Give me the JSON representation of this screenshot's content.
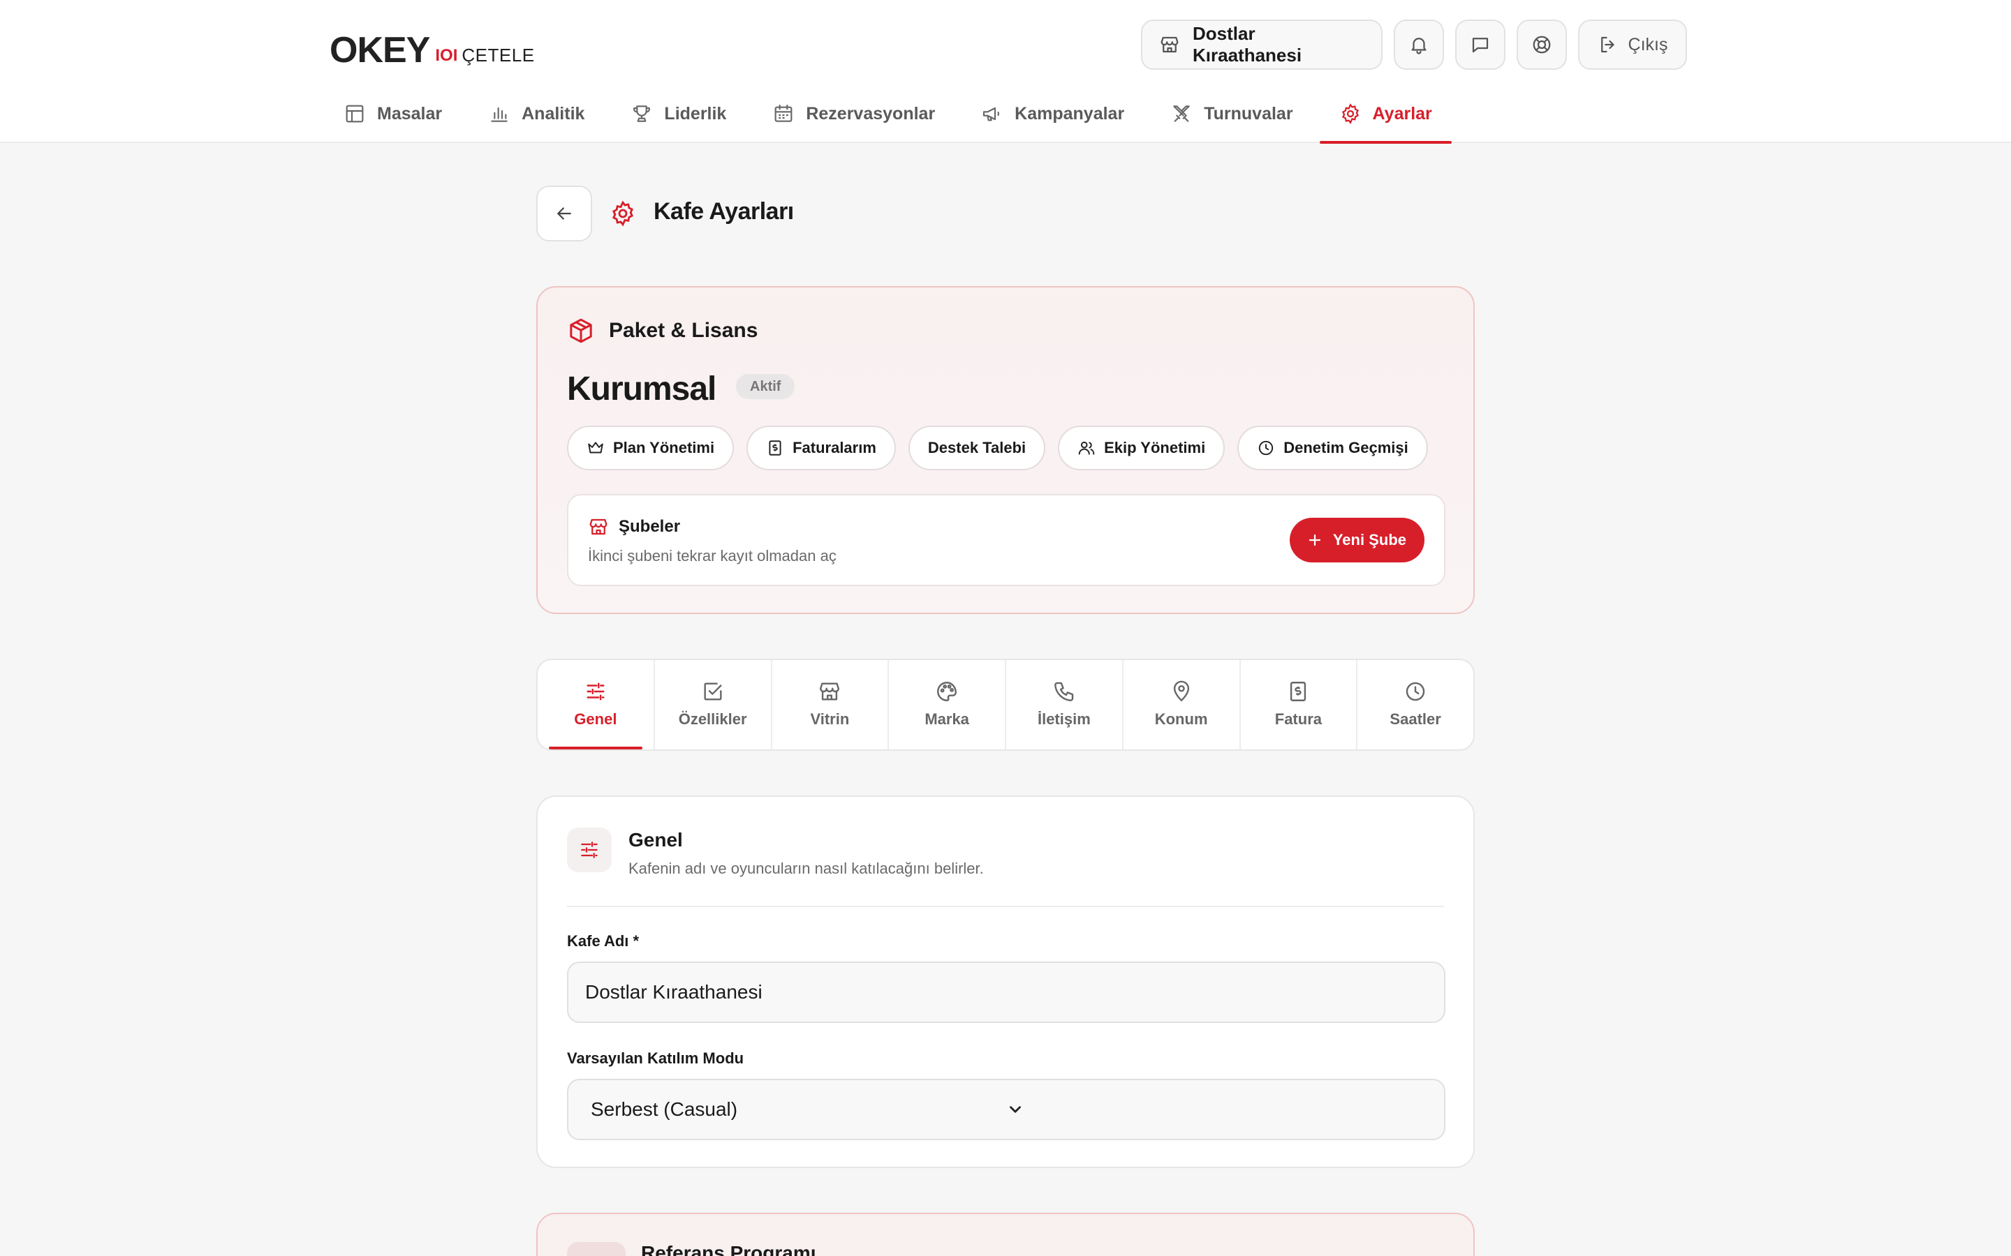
{
  "brand": {
    "logo_okey": "OKEY",
    "logo_tile": "IOI",
    "logo_cetele": "ÇETELE",
    "accent_color": "#d71f2a"
  },
  "header": {
    "cafe_name": "Dostlar Kıraathanesi",
    "logout_label": "Çıkış",
    "icons": {
      "cafe": "store-icon",
      "notifications": "bell-icon",
      "messages": "message-icon",
      "support": "lifebuoy-icon",
      "logout": "logout-icon"
    }
  },
  "nav": {
    "items": [
      {
        "label": "Masalar",
        "icon": "table-icon"
      },
      {
        "label": "Analitik",
        "icon": "bar-chart-icon"
      },
      {
        "label": "Liderlik",
        "icon": "trophy-icon"
      },
      {
        "label": "Rezervasyonlar",
        "icon": "calendar-icon"
      },
      {
        "label": "Kampanyalar",
        "icon": "megaphone-icon"
      },
      {
        "label": "Turnuvalar",
        "icon": "swords-icon"
      },
      {
        "label": "Ayarlar",
        "icon": "gear-icon",
        "active": true
      }
    ]
  },
  "page": {
    "title": "Kafe Ayarları"
  },
  "package": {
    "heading": "Paket & Lisans",
    "plan_name": "Kurumsal",
    "status": "Aktif",
    "actions": [
      {
        "label": "Plan Yönetimi",
        "icon": "crown-icon"
      },
      {
        "label": "Faturalarım",
        "icon": "receipt-icon"
      },
      {
        "label": "Destek Talebi",
        "icon": ""
      },
      {
        "label": "Ekip Yönetimi",
        "icon": "users-icon"
      },
      {
        "label": "Denetim Geçmişi",
        "icon": "clock-icon"
      }
    ],
    "branches": {
      "title": "Şubeler",
      "subtitle": "İkinci şubeni tekrar kayıt olmadan aç",
      "new_button": "Yeni Şube"
    }
  },
  "tabs": [
    {
      "label": "Genel",
      "icon": "sliders-icon",
      "active": true
    },
    {
      "label": "Özellikler",
      "icon": "checkbox-icon"
    },
    {
      "label": "Vitrin",
      "icon": "store-icon"
    },
    {
      "label": "Marka",
      "icon": "palette-icon"
    },
    {
      "label": "İletişim",
      "icon": "phone-icon"
    },
    {
      "label": "Konum",
      "icon": "map-pin-icon"
    },
    {
      "label": "Fatura",
      "icon": "receipt-icon"
    },
    {
      "label": "Saatler",
      "icon": "clock-icon"
    }
  ],
  "general": {
    "title": "Genel",
    "subtitle": "Kafenin adı ve oyuncuların nasıl katılacağını belirler.",
    "cafe_name_label": "Kafe Adı *",
    "cafe_name_value": "Dostlar Kıraathanesi",
    "join_mode_label": "Varsayılan Katılım Modu",
    "join_mode_value": "Serbest (Casual)"
  },
  "referral": {
    "title": "Referans Programı"
  }
}
